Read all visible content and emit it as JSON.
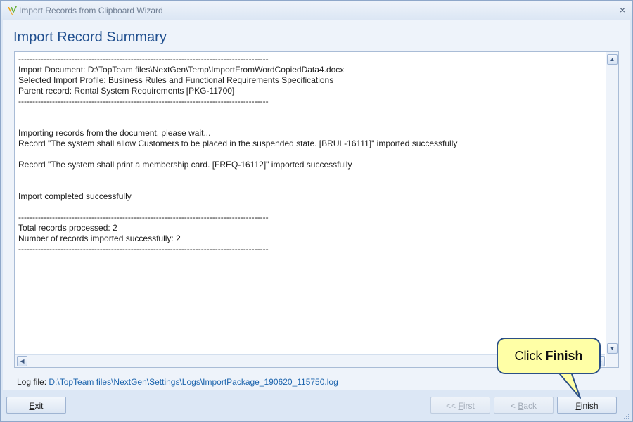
{
  "window": {
    "title": "Import Records from Clipboard Wizard",
    "close_glyph": "×"
  },
  "page_title": "Import Record Summary",
  "log": {
    "lines": [
      "-----------------------------------------------------------------------------------------",
      "Import Document: D:\\TopTeam files\\NextGen\\Temp\\ImportFromWordCopiedData4.docx",
      "Selected Import Profile: Business Rules and Functional Requirements Specifications",
      "Parent record: Rental System Requirements [PKG-11700]",
      "-----------------------------------------------------------------------------------------",
      "",
      "",
      "Importing records from the document, please wait...",
      "Record \"The system shall allow Customers to be placed in the suspended state. [BRUL-16111]\" imported successfully",
      "",
      "Record \"The system shall print a membership card. [FREQ-16112]\" imported successfully",
      "",
      "",
      "Import completed successfully",
      "",
      "-----------------------------------------------------------------------------------------",
      "Total records processed: 2",
      "Number of records imported successfully: 2",
      "-----------------------------------------------------------------------------------------"
    ]
  },
  "log_file": {
    "label": "Log file:",
    "path": "D:\\TopTeam files\\NextGen\\Settings\\Logs\\ImportPackage_190620_115750.log"
  },
  "buttons": {
    "exit": {
      "mnemonic": "E",
      "rest": "xit"
    },
    "first": {
      "prefix": "<< ",
      "mnemonic": "F",
      "rest": "irst"
    },
    "back": {
      "prefix": "< ",
      "mnemonic": "B",
      "rest": "ack"
    },
    "finish": {
      "mnemonic": "F",
      "rest": "inish"
    }
  },
  "callout": {
    "prefix": "Click ",
    "bold": "Finish"
  },
  "colors": {
    "accent": "#1f4e8e",
    "link": "#1c64ad",
    "callout_bg": "#ffffa6"
  },
  "icons": [
    "app-icon",
    "close-icon",
    "scroll-up-icon",
    "scroll-down-icon",
    "scroll-left-icon",
    "scroll-right-icon",
    "resize-grip-icon"
  ]
}
